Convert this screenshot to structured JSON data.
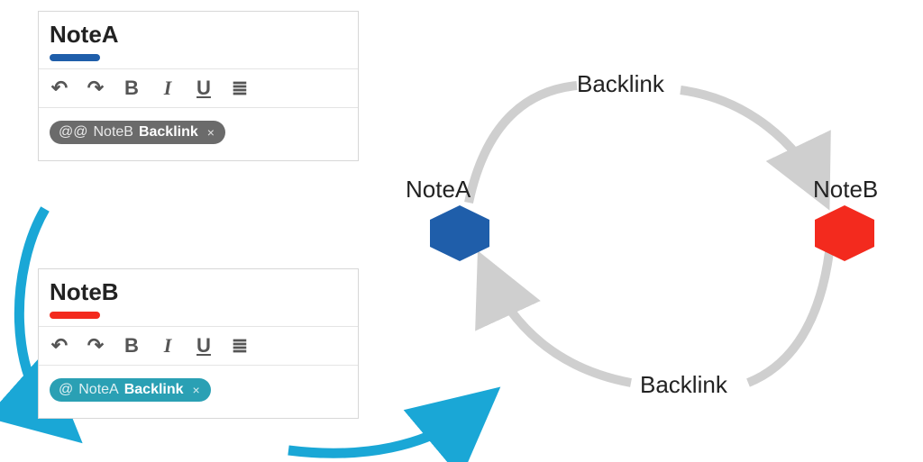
{
  "noteA": {
    "title": "NoteA",
    "accent": "#1f5eaa",
    "toolbar": {
      "undo": "↶",
      "redo": "↷",
      "bold": "B",
      "italic": "I",
      "underline": "U",
      "list": "≣"
    },
    "chip": {
      "prefix": "@@",
      "target": "NoteB",
      "suffix": "Backlink",
      "close": "×",
      "bg": "#6b6b6b"
    }
  },
  "noteB": {
    "title": "NoteB",
    "accent": "#f32a1e",
    "toolbar": {
      "undo": "↶",
      "redo": "↷",
      "bold": "B",
      "italic": "I",
      "underline": "U",
      "list": "≣"
    },
    "chip": {
      "prefix": "@",
      "target": "NoteA",
      "suffix": "Backlink",
      "close": "×",
      "bg": "#2aa0b4"
    }
  },
  "graph": {
    "nodeA": {
      "label": "NoteA",
      "color": "#1f5eaa"
    },
    "nodeB": {
      "label": "NoteB",
      "color": "#f32a1e"
    },
    "edgeTopLabel": "Backlink",
    "edgeBottomLabel": "Backlink"
  },
  "arrowColor": "#1aa7d6"
}
